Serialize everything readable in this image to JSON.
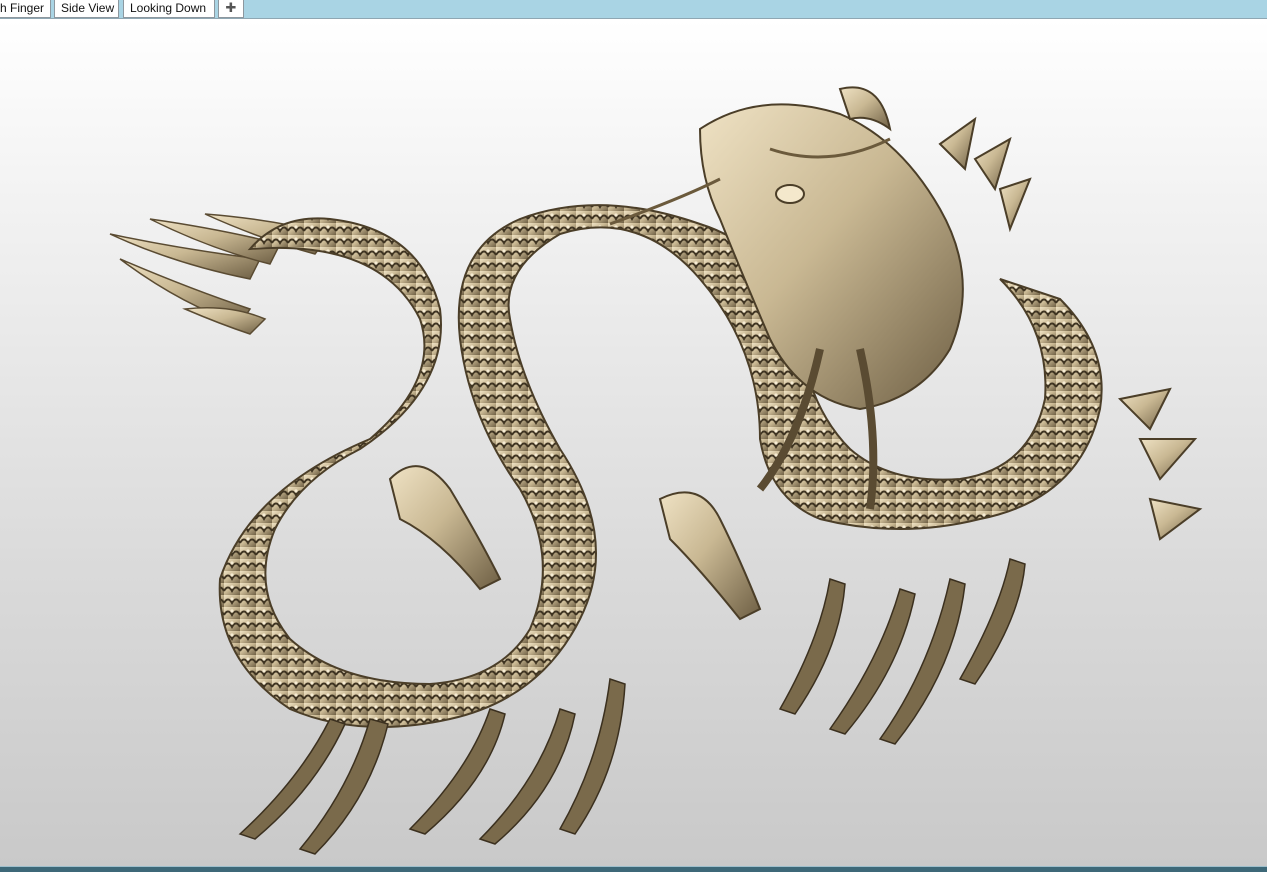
{
  "tabs": [
    {
      "label": "h Finger",
      "active": false
    },
    {
      "label": "Side View",
      "active": false
    },
    {
      "label": "Looking Down",
      "active": true
    }
  ],
  "add_tab_icon": "plus-icon",
  "viewport": {
    "model": "dragon-sculpture",
    "material_color": "#c9b893",
    "background_top": "#ffffff",
    "background_bottom": "#c9c9c9"
  },
  "colors": {
    "tabbar": "#a9d4e4",
    "statusbar": "#3d6878"
  }
}
